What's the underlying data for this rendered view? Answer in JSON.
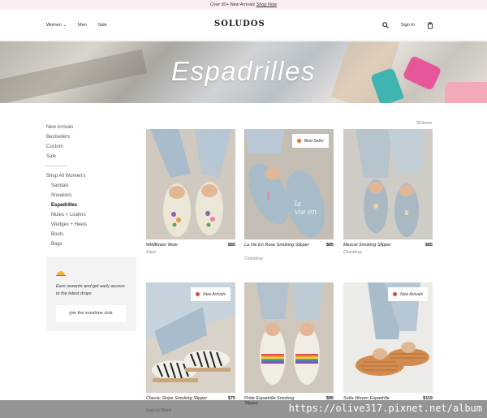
{
  "promo": {
    "text": "Over 30+ New Arrivals",
    "link": "Shop Now"
  },
  "nav": {
    "left": [
      "Women",
      "Men",
      "Sale"
    ],
    "logo": "SOLUDOS",
    "sign_in": "Sign In",
    "icons": [
      "search-icon",
      "cart-icon"
    ]
  },
  "hero": {
    "title": "Espadrilles"
  },
  "sidebar": {
    "top": [
      "New Arrivals",
      "Bestsellers",
      "Custom",
      "Sale"
    ],
    "section": "Shop All Women's",
    "sub": [
      "Sandals",
      "Sneakers",
      "Espadrilles",
      "Mules + Loafers",
      "Wedges + Heels",
      "Boots",
      "Bags"
    ],
    "active": "Espadrilles"
  },
  "rewards": {
    "text": "Earn rewards and get early access to the latest drops",
    "button": "join the sunshine club"
  },
  "count": "58 items",
  "products": [
    {
      "name": "Wildflower Mule",
      "price": "$85",
      "color": "Sand",
      "badge": ""
    },
    {
      "name": "La Vie En Rose Smoking Slipper",
      "price": "$85",
      "color": "Chambray",
      "badge": "Best Seller"
    },
    {
      "name": "Mezcal Smoking Slipper",
      "price": "$85",
      "color": "Chambray",
      "badge": ""
    },
    {
      "name": "Classic Stripe Smoking Slipper",
      "price": "$75",
      "color": "Natural/ Black",
      "badge": "New Arrivals"
    },
    {
      "name": "Pride Espadrille Smoking Slipper",
      "price": "$85",
      "color": "",
      "badge": ""
    },
    {
      "name": "Sofia Woven Espadrille",
      "price": "$119",
      "color": "",
      "badge": "New Arrivals"
    }
  ],
  "watermark": "https://olive317.pixnet.net/album",
  "colors": {
    "promo_bg": "#fbeef0",
    "badge_fire": "#f06a2a",
    "badge_new": "#e2473b",
    "rewards_bg": "#f3f3f3"
  }
}
